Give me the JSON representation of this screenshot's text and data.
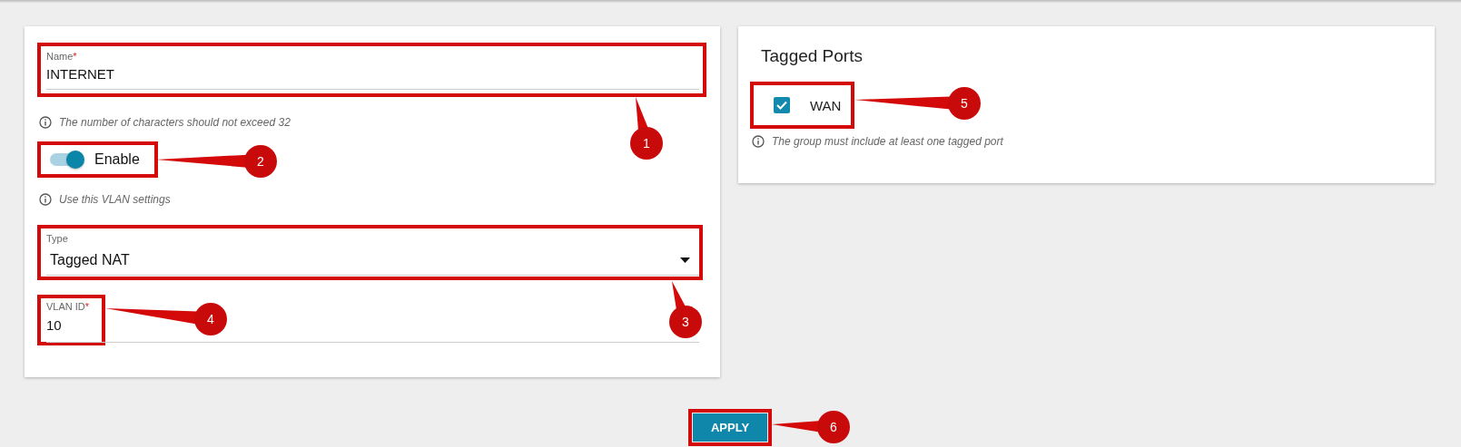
{
  "vlan": {
    "name_field": {
      "label": "Name",
      "required_mark": "*",
      "value": "INTERNET",
      "hint": "The number of characters should not exceed 32"
    },
    "enable": {
      "label": "Enable",
      "on": true,
      "hint": "Use this VLAN settings"
    },
    "type_field": {
      "label": "Type",
      "value": "Tagged NAT"
    },
    "vlan_id_field": {
      "label": "VLAN ID",
      "required_mark": "*",
      "value": "10"
    }
  },
  "tagged_ports": {
    "title": "Tagged Ports",
    "ports": [
      {
        "label": "WAN",
        "checked": true
      }
    ],
    "hint": "The group must include at least one tagged port"
  },
  "apply_button": "APPLY",
  "callouts": [
    {
      "number": "1"
    },
    {
      "number": "2"
    },
    {
      "number": "3"
    },
    {
      "number": "4"
    },
    {
      "number": "5"
    },
    {
      "number": "6"
    }
  ]
}
